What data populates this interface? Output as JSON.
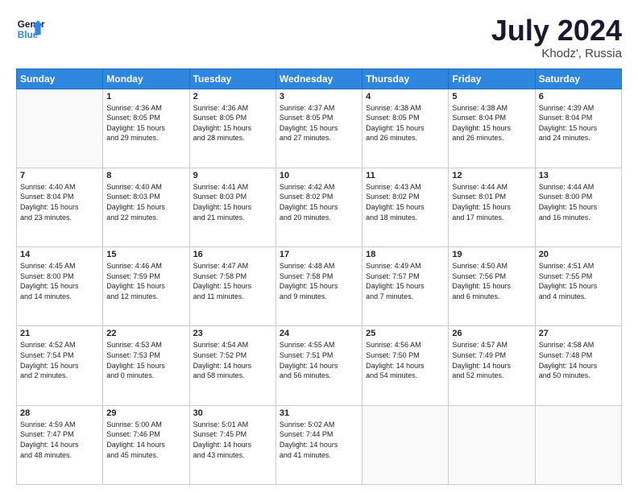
{
  "header": {
    "logo_line1": "General",
    "logo_line2": "Blue",
    "title": "July 2024",
    "location": "Khodz', Russia"
  },
  "days_of_week": [
    "Sunday",
    "Monday",
    "Tuesday",
    "Wednesday",
    "Thursday",
    "Friday",
    "Saturday"
  ],
  "weeks": [
    [
      {
        "day": "",
        "content": ""
      },
      {
        "day": "1",
        "content": "Sunrise: 4:36 AM\nSunset: 8:05 PM\nDaylight: 15 hours\nand 29 minutes."
      },
      {
        "day": "2",
        "content": "Sunrise: 4:36 AM\nSunset: 8:05 PM\nDaylight: 15 hours\nand 28 minutes."
      },
      {
        "day": "3",
        "content": "Sunrise: 4:37 AM\nSunset: 8:05 PM\nDaylight: 15 hours\nand 27 minutes."
      },
      {
        "day": "4",
        "content": "Sunrise: 4:38 AM\nSunset: 8:05 PM\nDaylight: 15 hours\nand 26 minutes."
      },
      {
        "day": "5",
        "content": "Sunrise: 4:38 AM\nSunset: 8:04 PM\nDaylight: 15 hours\nand 26 minutes."
      },
      {
        "day": "6",
        "content": "Sunrise: 4:39 AM\nSunset: 8:04 PM\nDaylight: 15 hours\nand 24 minutes."
      }
    ],
    [
      {
        "day": "7",
        "content": "Sunrise: 4:40 AM\nSunset: 8:04 PM\nDaylight: 15 hours\nand 23 minutes."
      },
      {
        "day": "8",
        "content": "Sunrise: 4:40 AM\nSunset: 8:03 PM\nDaylight: 15 hours\nand 22 minutes."
      },
      {
        "day": "9",
        "content": "Sunrise: 4:41 AM\nSunset: 8:03 PM\nDaylight: 15 hours\nand 21 minutes."
      },
      {
        "day": "10",
        "content": "Sunrise: 4:42 AM\nSunset: 8:02 PM\nDaylight: 15 hours\nand 20 minutes."
      },
      {
        "day": "11",
        "content": "Sunrise: 4:43 AM\nSunset: 8:02 PM\nDaylight: 15 hours\nand 18 minutes."
      },
      {
        "day": "12",
        "content": "Sunrise: 4:44 AM\nSunset: 8:01 PM\nDaylight: 15 hours\nand 17 minutes."
      },
      {
        "day": "13",
        "content": "Sunrise: 4:44 AM\nSunset: 8:00 PM\nDaylight: 15 hours\nand 16 minutes."
      }
    ],
    [
      {
        "day": "14",
        "content": "Sunrise: 4:45 AM\nSunset: 8:00 PM\nDaylight: 15 hours\nand 14 minutes."
      },
      {
        "day": "15",
        "content": "Sunrise: 4:46 AM\nSunset: 7:59 PM\nDaylight: 15 hours\nand 12 minutes."
      },
      {
        "day": "16",
        "content": "Sunrise: 4:47 AM\nSunset: 7:58 PM\nDaylight: 15 hours\nand 11 minutes."
      },
      {
        "day": "17",
        "content": "Sunrise: 4:48 AM\nSunset: 7:58 PM\nDaylight: 15 hours\nand 9 minutes."
      },
      {
        "day": "18",
        "content": "Sunrise: 4:49 AM\nSunset: 7:57 PM\nDaylight: 15 hours\nand 7 minutes."
      },
      {
        "day": "19",
        "content": "Sunrise: 4:50 AM\nSunset: 7:56 PM\nDaylight: 15 hours\nand 6 minutes."
      },
      {
        "day": "20",
        "content": "Sunrise: 4:51 AM\nSunset: 7:55 PM\nDaylight: 15 hours\nand 4 minutes."
      }
    ],
    [
      {
        "day": "21",
        "content": "Sunrise: 4:52 AM\nSunset: 7:54 PM\nDaylight: 15 hours\nand 2 minutes."
      },
      {
        "day": "22",
        "content": "Sunrise: 4:53 AM\nSunset: 7:53 PM\nDaylight: 15 hours\nand 0 minutes."
      },
      {
        "day": "23",
        "content": "Sunrise: 4:54 AM\nSunset: 7:52 PM\nDaylight: 14 hours\nand 58 minutes."
      },
      {
        "day": "24",
        "content": "Sunrise: 4:55 AM\nSunset: 7:51 PM\nDaylight: 14 hours\nand 56 minutes."
      },
      {
        "day": "25",
        "content": "Sunrise: 4:56 AM\nSunset: 7:50 PM\nDaylight: 14 hours\nand 54 minutes."
      },
      {
        "day": "26",
        "content": "Sunrise: 4:57 AM\nSunset: 7:49 PM\nDaylight: 14 hours\nand 52 minutes."
      },
      {
        "day": "27",
        "content": "Sunrise: 4:58 AM\nSunset: 7:48 PM\nDaylight: 14 hours\nand 50 minutes."
      }
    ],
    [
      {
        "day": "28",
        "content": "Sunrise: 4:59 AM\nSunset: 7:47 PM\nDaylight: 14 hours\nand 48 minutes."
      },
      {
        "day": "29",
        "content": "Sunrise: 5:00 AM\nSunset: 7:46 PM\nDaylight: 14 hours\nand 45 minutes."
      },
      {
        "day": "30",
        "content": "Sunrise: 5:01 AM\nSunset: 7:45 PM\nDaylight: 14 hours\nand 43 minutes."
      },
      {
        "day": "31",
        "content": "Sunrise: 5:02 AM\nSunset: 7:44 PM\nDaylight: 14 hours\nand 41 minutes."
      },
      {
        "day": "",
        "content": ""
      },
      {
        "day": "",
        "content": ""
      },
      {
        "day": "",
        "content": ""
      }
    ]
  ]
}
